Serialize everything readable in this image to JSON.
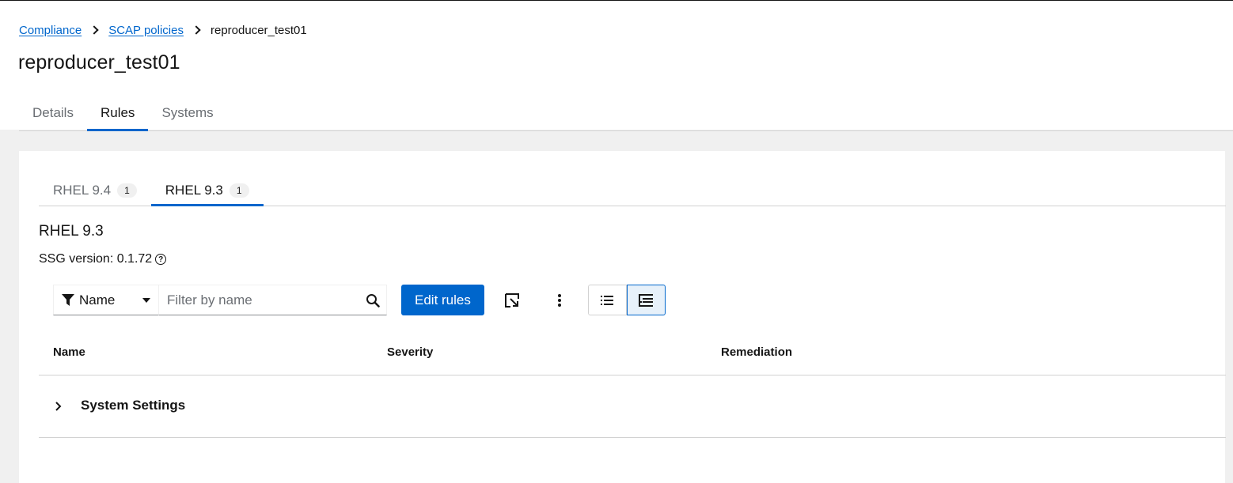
{
  "breadcrumb": {
    "items": [
      {
        "label": "Compliance"
      },
      {
        "label": "SCAP policies"
      },
      {
        "label": "reproducer_test01"
      }
    ]
  },
  "page": {
    "title": "reproducer_test01"
  },
  "main_tabs": [
    {
      "label": "Details"
    },
    {
      "label": "Rules"
    },
    {
      "label": "Systems"
    }
  ],
  "os_tabs": [
    {
      "label": "RHEL 9.4",
      "count": "1"
    },
    {
      "label": "RHEL 9.3",
      "count": "1"
    }
  ],
  "section": {
    "title": "RHEL 9.3",
    "ssg_version": "SSG version: 0.1.72"
  },
  "toolbar": {
    "filter_attribute": "Name",
    "search_placeholder": "Filter by name",
    "edit_rules_label": "Edit rules"
  },
  "table": {
    "columns": [
      "Name",
      "Severity",
      "Remediation"
    ],
    "rows": [
      {
        "label": "System Settings"
      }
    ]
  },
  "colors": {
    "accent": "#0066cc",
    "text": "#151515",
    "muted": "#6a6e73",
    "border": "#d2d2d2"
  }
}
